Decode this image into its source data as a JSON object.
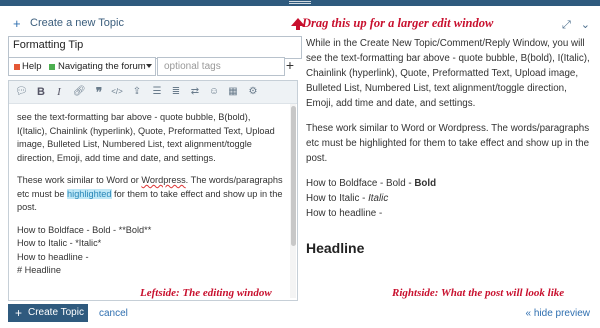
{
  "header": {
    "title": "Create a new Topic",
    "drag_note": "Drag this up for a larger edit window"
  },
  "composer": {
    "title_value": "Formatting Tip",
    "category": {
      "label1": "Help",
      "label2": "Navigating the forum",
      "color1": "#e45735",
      "color2": "#4caf50"
    },
    "tags_placeholder": "optional tags"
  },
  "editor": {
    "toolbar": [
      "quote-icon",
      "bold-icon",
      "italic-icon",
      "link-icon",
      "blockquote-icon",
      "code-icon",
      "upload-icon",
      "bullet-list-icon",
      "numbered-list-icon",
      "text-direction-icon",
      "emoji-icon",
      "calendar-icon",
      "settings-icon"
    ],
    "p1": "see the text-formatting bar above - quote bubble, B(bold), I(Italic), Chainlink (hyperlink), Quote, Preformatted Text, Upload image, Bulleted List, Numbered List, text alignment/toggle direction, Emoji, add time and date, and settings.",
    "p2_a": "These work similar to Word or ",
    "p2_w": "Wordpress",
    "p2_b": ". The words/paragraphs etc must be ",
    "p2_h": "highlighted",
    "p2_c": " for them to take effect and show up in the post.",
    "l1": "How to Boldface - Bold - **Bold**",
    "l2": "How to Italic - *Italic*",
    "l3": "How to headline -",
    "l4": "# Headline",
    "note": "Leftside: The editing window"
  },
  "preview": {
    "p1": "While in the Create New Topic/Comment/Reply Window, you will see the text-formatting bar above - quote bubble, B(bold), I(Italic), Chainlink (hyperlink), Quote, Preformatted Text, Upload image, Bulleted List, Numbered List, text alignment/toggle direction, Emoji, add time and date, and settings.",
    "p2": "These work similar to Word or Wordpress. The words/paragraphs etc must be highlighted for them to take effect and show up in the post.",
    "bold_prefix": "How to Boldface - Bold - ",
    "bold_word": "Bold",
    "italic_prefix": "How to Italic - ",
    "italic_word": "Italic",
    "headline_line": "How to headline -",
    "headline": "Headline",
    "note": "Rightside: What the post will look like"
  },
  "footer": {
    "create_label": "Create Topic",
    "cancel_label": "cancel",
    "hide_preview_label": "« hide preview"
  },
  "colors": {
    "accent": "#2f5a7e",
    "link": "#2f6fb0",
    "annotation": "#c8102e"
  }
}
